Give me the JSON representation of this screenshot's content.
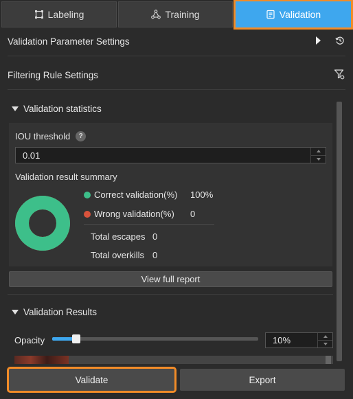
{
  "tabs": [
    {
      "label": "Labeling",
      "icon": "bounding-box-icon",
      "active": false
    },
    {
      "label": "Training",
      "icon": "network-icon",
      "active": false
    },
    {
      "label": "Validation",
      "icon": "clipboard-check-icon",
      "active": true
    }
  ],
  "settings": {
    "validation_param_label": "Validation Parameter Settings",
    "filtering_rule_label": "Filtering Rule Settings"
  },
  "validation_statistics": {
    "title": "Validation statistics",
    "iou_label": "IOU threshold",
    "iou_help": "?",
    "iou_value": "0.01",
    "summary_label": "Validation result summary",
    "correct_label": "Correct validation(%)",
    "correct_value": "100%",
    "correct_fraction": 1.0,
    "wrong_label": "Wrong validation(%)",
    "wrong_value": "0",
    "escapes_label": "Total escapes",
    "escapes_value": "0",
    "overkills_label": "Total overkills",
    "overkills_value": "0",
    "report_button": "View full report"
  },
  "validation_results": {
    "title": "Validation Results",
    "opacity_label": "Opacity",
    "opacity_value": "10%",
    "opacity_fraction": 0.1
  },
  "buttons": {
    "validate": "Validate",
    "export": "Export"
  },
  "colors": {
    "accent": "#3ea7ee",
    "highlight": "#f28c28",
    "correct": "#3dbf8a",
    "wrong": "#d9533c"
  }
}
